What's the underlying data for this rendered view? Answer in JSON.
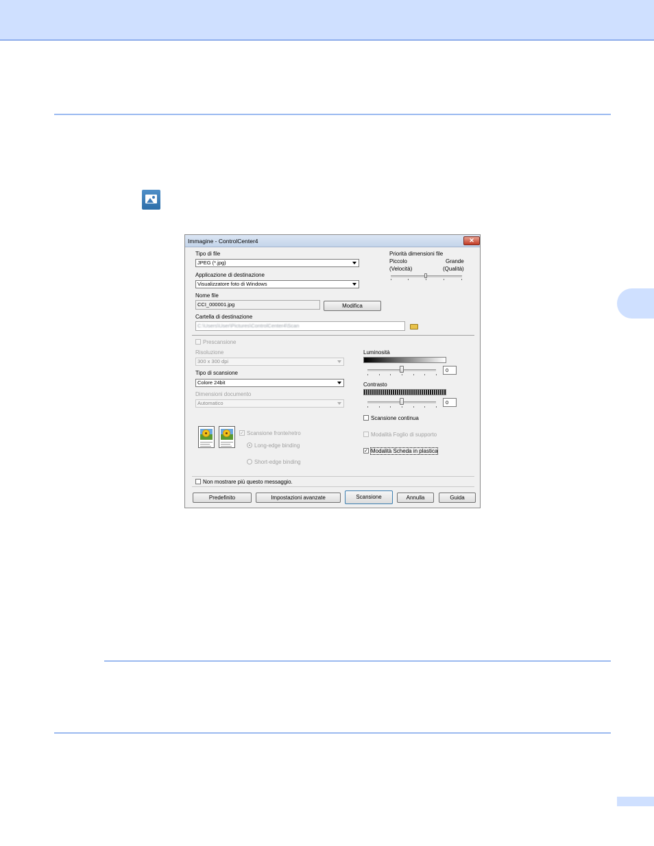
{
  "dialog": {
    "title": "Immagine - ControlCenter4",
    "close_glyph": "✕",
    "file_type": {
      "label": "Tipo di file",
      "value": "JPEG (*.jpg)"
    },
    "target_app": {
      "label": "Applicazione di destinazione",
      "value": "Visualizzatore foto di Windows"
    },
    "file_name": {
      "label": "Nome file",
      "value": "CCI_000001.jpg",
      "button": "Modifica"
    },
    "dest_folder": {
      "label": "Cartella di destinazione",
      "value": "C:\\Users\\User\\Pictures\\ControlCenter4\\Scan"
    },
    "file_size_priority": {
      "label": "Priorità dimensioni file",
      "small": "Piccolo",
      "small_sub": "(Velocità)",
      "large": "Grande",
      "large_sub": "(Qualità)",
      "level_fraction": 0.5
    },
    "prescan": {
      "label": "Prescansione",
      "checked": false
    },
    "resolution": {
      "label": "Risoluzione",
      "value": "300 x 300 dpi"
    },
    "scan_type": {
      "label": "Tipo di scansione",
      "value": "Colore 24bit"
    },
    "doc_size": {
      "label": "Dimensioni documento",
      "value": "Automatico"
    },
    "brightness": {
      "label": "Luminosità",
      "value": "0",
      "level_fraction": 0.5
    },
    "contrast": {
      "label": "Contrasto",
      "value": "0",
      "level_fraction": 0.5
    },
    "continuous_scan": {
      "label": "Scansione continua",
      "checked": false
    },
    "carrier_sheet": {
      "label": "Modalità Foglio di supporto",
      "checked": false
    },
    "plastic_card": {
      "label": "Modalità Scheda in plastica",
      "checked": true
    },
    "duplex": {
      "label": "Scansione fronte/retro",
      "checked": true,
      "long_edge": "Long-edge binding",
      "short_edge": "Short-edge binding",
      "selected": "long_edge"
    },
    "dont_show": {
      "label": "Non mostrare più questo messaggio.",
      "checked": false
    },
    "buttons": {
      "default": "Predefinito",
      "advanced": "Impostazioni avanzate",
      "scan": "Scansione",
      "cancel": "Annulla",
      "help": "Guida"
    },
    "checkmark_glyph": "✓"
  },
  "colors": {
    "header_band": "#cfe0ff",
    "rule": "#9ab9f0",
    "accent": "#3b6fd8"
  },
  "icons": {
    "page_icon": "image-icon"
  }
}
